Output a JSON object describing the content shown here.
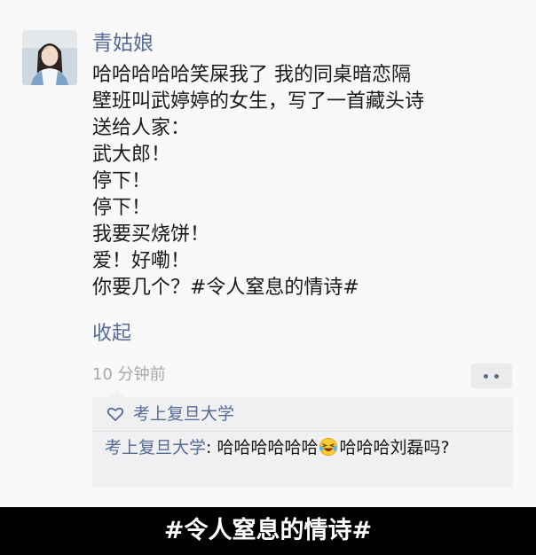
{
  "post": {
    "username": "青姑娘",
    "lines": [
      "哈哈哈哈哈笑屎我了 我的同桌暗恋隔",
      "壁班叫武婷婷的女生，写了一首藏头诗",
      "送给人家：",
      "武大郎！",
      "停下！",
      "停下！",
      "我要买烧饼！",
      "爱！好嘞！",
      "你要几个？#令人窒息的情诗#"
    ],
    "collapse_label": "收起",
    "timestamp": "10 分钟前",
    "more_icon": "ellipsis-icon"
  },
  "likes": {
    "icon": "heart-icon",
    "names": "考上复旦大学"
  },
  "comment": {
    "author": "考上复旦大学",
    "separator": ": ",
    "text_before_emoji": "哈哈哈哈哈哈",
    "emoji": "laughing-tears-emoji",
    "text_after_emoji": "哈哈哈刘磊吗?"
  },
  "caption": "#令人窒息的情诗#",
  "colors": {
    "link_blue": "#576b95",
    "text": "#191919",
    "meta_gray": "#a8a8a8",
    "comment_bg": "#f0f0f2",
    "caption_bg": "#000000"
  }
}
